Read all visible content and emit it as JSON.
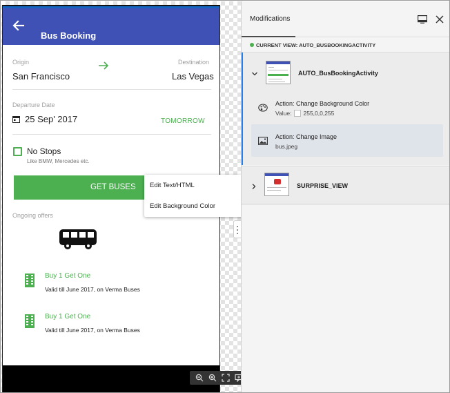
{
  "app": {
    "title": "Bus Booking",
    "origin_label": "Origin",
    "origin_value": "San Francisco",
    "destination_label": "Destination",
    "destination_value": "Las Vegas",
    "departure_label": "Departure Date",
    "departure_value": "25 Sep' 2017",
    "tomorrow_label": "TOMORROW",
    "nostops_label": "No Stops",
    "nostops_sub": "Like BMW, Mercedes etc.",
    "get_buses_label": "GET BUSES",
    "ongoing_label": "Ongoing offers",
    "offers": [
      {
        "title": "Buy 1 Get One",
        "subtitle": "Valid till June 2017, on Verma Buses"
      },
      {
        "title": "Buy 1 Get One",
        "subtitle": "Valid till June 2017, on Verma Buses"
      }
    ]
  },
  "context_menu": {
    "items": [
      "Edit Text/HTML",
      "Edit Background Color"
    ]
  },
  "toolbar": {
    "icons": [
      "zoom-out-icon",
      "zoom-in-icon",
      "fit-screen-icon",
      "comment-icon",
      "chat-icon"
    ]
  },
  "panel": {
    "tab_label": "Modifications",
    "current_view_label": "CURRENT VIEW: AUTO_BUSBOOKINGACTIVITY",
    "views": [
      {
        "name": "AUTO_BusBookingActivity",
        "expanded": true,
        "actions": [
          {
            "title": "Action: Change Background Color",
            "value_label": "Value:",
            "value": "255,0,0,255",
            "icon": "palette-icon"
          },
          {
            "title": "Action: Change Image",
            "value": "bus.jpeg",
            "icon": "image-icon"
          }
        ]
      },
      {
        "name": "SURPRISE_VIEW",
        "expanded": false
      }
    ]
  },
  "colors": {
    "app_header": "#3f51b5",
    "accent_green": "#4caf50",
    "selection_blue": "#2680eb",
    "status_dot": "#4caf50"
  }
}
